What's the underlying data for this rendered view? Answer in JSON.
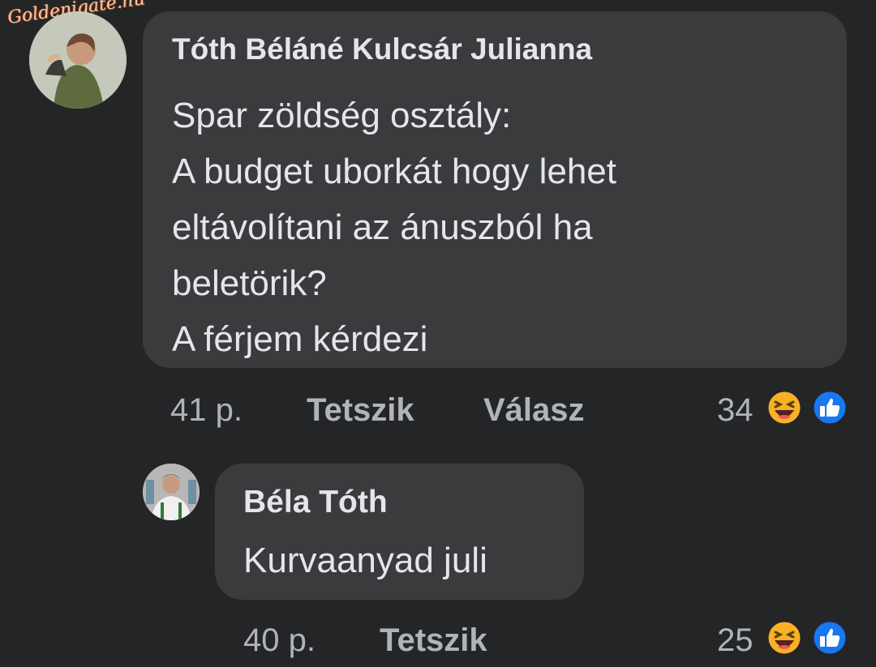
{
  "watermark": "Goldenigate.hu",
  "comment": {
    "author": "Tóth Béláné Kulcsár Julianna",
    "lines": [
      "Spar zöldség osztály:",
      "A budget uborkát hogy lehet",
      "eltávolítani az ánuszból ha",
      "beletörik?",
      "A férjem kérdezi"
    ],
    "time": "41 p.",
    "like_label": "Tetszik",
    "reply_label": "Válasz",
    "reaction_count": "34",
    "reactions": [
      "haha-icon",
      "like-icon"
    ]
  },
  "reply": {
    "author": "Béla Tóth",
    "text": "Kurvaanyad juli",
    "time": "40 p.",
    "like_label": "Tetszik",
    "reaction_count": "25",
    "reactions": [
      "haha-icon",
      "like-icon"
    ]
  },
  "colors": {
    "background": "#242526",
    "bubble": "#3a3b3c",
    "text": "#e4e6eb",
    "meta": "#b0b3b8",
    "like_blue": "#1877f2",
    "haha_yellow": "#f7b125"
  }
}
